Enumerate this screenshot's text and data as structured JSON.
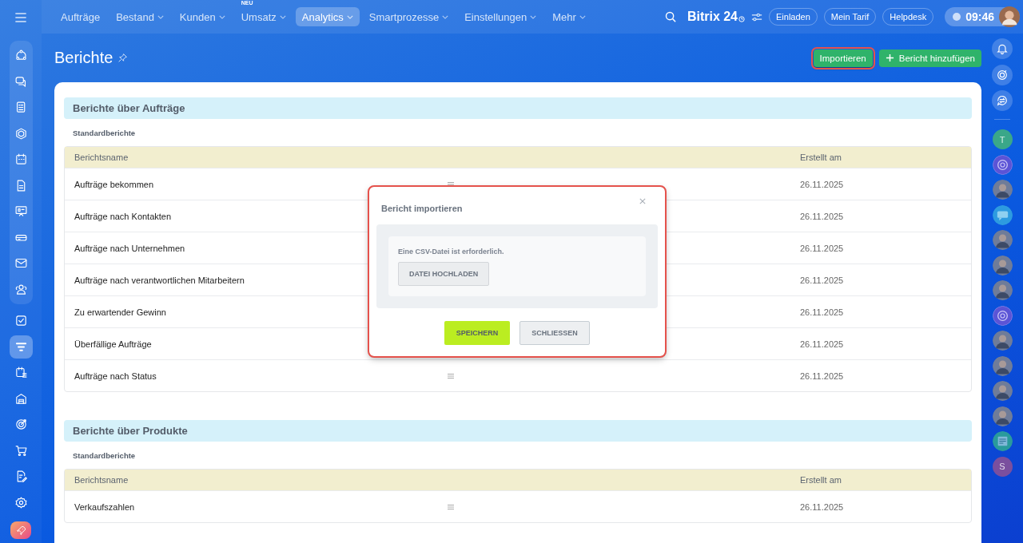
{
  "top_nav": {
    "items": [
      {
        "label": "Aufträge",
        "selected": false,
        "has_menu": false
      },
      {
        "label": "Bestand",
        "selected": false,
        "has_menu": true
      },
      {
        "label": "Kunden",
        "selected": false,
        "has_menu": true
      },
      {
        "label": "Umsatz",
        "selected": false,
        "has_menu": true,
        "badge": "NEU"
      },
      {
        "label": "Analytics",
        "selected": true,
        "has_menu": true
      },
      {
        "label": "Smartprozesse",
        "selected": false,
        "has_menu": true
      },
      {
        "label": "Einstellungen",
        "selected": false,
        "has_menu": true
      },
      {
        "label": "Mehr",
        "selected": false,
        "has_menu": true
      }
    ],
    "brand": {
      "name": "Bitrix",
      "number": "24"
    },
    "buttons": [
      "Einladen",
      "Mein Tarif",
      "Helpdesk"
    ],
    "time": "09:46"
  },
  "left_sidebar": {
    "pinned": [
      {
        "selected": false
      },
      {
        "selected": false
      },
      {
        "selected": false
      },
      {
        "selected": false
      },
      {
        "selected": false
      },
      {
        "selected": false
      },
      {
        "selected": false
      },
      {
        "selected": false
      },
      {
        "selected": false
      },
      {
        "selected": false
      }
    ],
    "items": [
      {
        "selected": false
      },
      {
        "selected": true
      },
      {
        "selected": false
      },
      {
        "selected": false
      },
      {
        "selected": false
      },
      {
        "selected": false
      },
      {
        "selected": false
      },
      {
        "selected": false
      }
    ]
  },
  "right_sidebar": {
    "chats": [
      {
        "kind": "letter",
        "text": "T",
        "color": "#3aa789"
      },
      {
        "kind": "copilot"
      },
      {
        "kind": "avatar"
      },
      {
        "kind": "chat"
      },
      {
        "kind": "avatar"
      },
      {
        "kind": "avatar"
      },
      {
        "kind": "avatar"
      },
      {
        "kind": "copilot"
      },
      {
        "kind": "avatar"
      },
      {
        "kind": "avatar"
      },
      {
        "kind": "avatar"
      },
      {
        "kind": "avatar"
      },
      {
        "kind": "news"
      },
      {
        "kind": "letter",
        "text": "S",
        "color": "#7a4f9e"
      }
    ]
  },
  "page": {
    "title": "Berichte",
    "actions": [
      {
        "label": "Importieren",
        "kind": "import",
        "highlighted": true
      },
      {
        "label": "Bericht hinzufügen",
        "kind": "add",
        "highlighted": false
      }
    ]
  },
  "sections": [
    {
      "title": "Berichte über Aufträge",
      "subtitle": "Standardberichte",
      "columns": [
        "Berichtsname",
        "Erstellt am"
      ],
      "rows": [
        {
          "name": "Aufträge bekommen",
          "drag_handle": true,
          "created": "26.11.2025"
        },
        {
          "name": "Aufträge nach Kontakten",
          "created": "26.11.2025"
        },
        {
          "name": "Aufträge nach Unternehmen",
          "created": "26.11.2025"
        },
        {
          "name": "Aufträge nach verantwortlichen Mitarbeitern",
          "created": "26.11.2025"
        },
        {
          "name": "Zu erwartender Gewinn",
          "created": "26.11.2025"
        },
        {
          "name": "Überfällige Aufträge",
          "created": "26.11.2025"
        },
        {
          "name": "Aufträge nach Status",
          "drag_handle": true,
          "created": "26.11.2025"
        }
      ]
    },
    {
      "title": "Berichte über Produkte",
      "subtitle": "Standardberichte",
      "columns": [
        "Berichtsname",
        "Erstellt am"
      ],
      "rows": [
        {
          "name": "Verkaufszahlen",
          "drag_handle": true,
          "created": "26.11.2025"
        }
      ]
    }
  ],
  "dialog": {
    "title": "Bericht importieren",
    "highlighted": true,
    "hint": "Eine CSV-Datei ist erforderlich.",
    "upload": "DATEI HOCHLADEN",
    "buttons": [
      {
        "label": "SPEICHERN",
        "kind": "primary"
      },
      {
        "label": "SCHLIESSEN",
        "kind": "secondary"
      }
    ]
  }
}
